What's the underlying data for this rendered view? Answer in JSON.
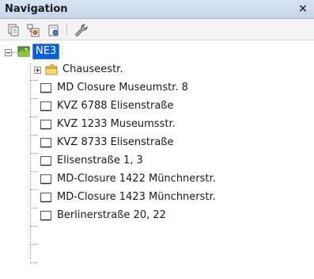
{
  "window": {
    "title": "Navigation",
    "close_glyph": "×"
  },
  "toolbar": {
    "buttons": [
      {
        "name": "copy-pages-icon"
      },
      {
        "name": "node-settings-icon"
      },
      {
        "name": "node-properties-icon"
      },
      {
        "name": "wrench-icon"
      }
    ]
  },
  "tree": {
    "root": {
      "label": "NE3",
      "icon": "map-node-icon",
      "selected": true
    },
    "folder": {
      "label": "Chauseestr.",
      "icon": "folder-icon"
    },
    "items": [
      {
        "label": "MD Closure Museumstr. 8"
      },
      {
        "label": "KVZ 6788 Elisenstraße"
      },
      {
        "label": "KVZ 1233 Museumsstr."
      },
      {
        "label": "KVZ 8733 Elisenstraße"
      },
      {
        "label": "Elisenstraße 1, 3"
      },
      {
        "label": "MD-Closure 1422 Münchnerstr."
      },
      {
        "label": "MD-Closure 1423 Münchnerstr."
      },
      {
        "label": "Berlinerstraße 20, 22"
      }
    ]
  },
  "colors": {
    "selection": "#0a63d6",
    "folder": "#f2c94c",
    "title_bar": "#c6d5ea"
  }
}
